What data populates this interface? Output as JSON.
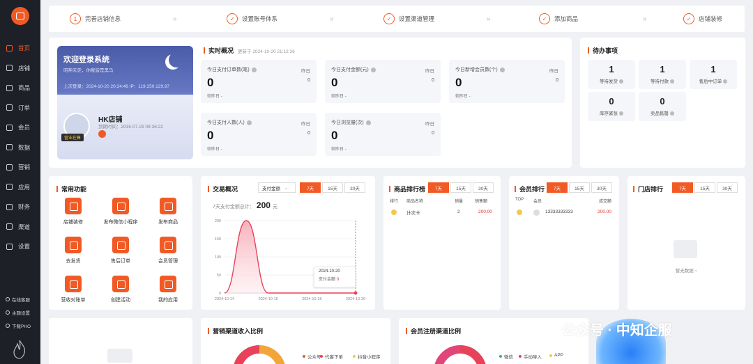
{
  "nav": {
    "items": [
      {
        "label": "首页",
        "icon": "home-icon"
      },
      {
        "label": "店铺",
        "icon": "store-icon"
      },
      {
        "label": "商品",
        "icon": "goods-icon"
      },
      {
        "label": "订单",
        "icon": "order-icon"
      },
      {
        "label": "会员",
        "icon": "member-icon"
      },
      {
        "label": "数据",
        "icon": "data-icon"
      },
      {
        "label": "营销",
        "icon": "marketing-icon"
      },
      {
        "label": "应用",
        "icon": "apps-icon"
      },
      {
        "label": "财务",
        "icon": "finance-icon"
      },
      {
        "label": "渠道",
        "icon": "channel-icon"
      },
      {
        "label": "设置",
        "icon": "settings-icon"
      }
    ],
    "bottom": [
      "在线客服",
      "主题设置",
      "下载PHO"
    ]
  },
  "steps": [
    "完善店铺信息",
    "设置账号体系",
    "设置渠道管理",
    "添加商品",
    "店铺装修"
  ],
  "welcome": {
    "title": "欢迎登录系统",
    "subtitle": "昭神未定，你我皆是黑马",
    "last_login": "上次登录：2024-10-20 20:24:46 IP：119.250.129.97",
    "store_name": "HK店铺",
    "expire": "到期时间：2035-07-29 09:36:22",
    "store_tag": "营业在售"
  },
  "realtime": {
    "title": "实时概况",
    "updated": "更新于 2024-10-20 21:12:26",
    "yesterday_label": "昨日",
    "compare_label": "较昨日 -",
    "stats": [
      {
        "label": "今日支付订单数(笔)",
        "value": "0",
        "yesterday": "0"
      },
      {
        "label": "今日支付金额(元)",
        "value": "0",
        "yesterday": "0"
      },
      {
        "label": "今日新增会员数(个)",
        "value": "0",
        "yesterday": "0"
      },
      {
        "label": "今日支付人数(人)",
        "value": "0",
        "yesterday": "0"
      },
      {
        "label": "今日浏览量(次)",
        "value": "0",
        "yesterday": "0"
      }
    ]
  },
  "todo": {
    "title": "待办事项",
    "items": [
      {
        "count": "1",
        "label": "等待发货"
      },
      {
        "count": "1",
        "label": "等待付款"
      },
      {
        "count": "1",
        "label": "售后中订单"
      },
      {
        "count": "0",
        "label": "库存紧张"
      },
      {
        "count": "0",
        "label": "卖品售罄"
      }
    ]
  },
  "functions": {
    "title": "常用功能",
    "items": [
      "店铺装修",
      "发布微信小程序",
      "发布商品",
      "去发货",
      "售后订单",
      "会员管理",
      "营收对账单",
      "创建活动",
      "我的应用"
    ]
  },
  "trade": {
    "title": "交易概况",
    "select": "支付金额",
    "ranges": [
      "7天",
      "15天",
      "30天"
    ],
    "total_label": "7天支付金额总计：",
    "total_value": "200",
    "total_unit": "元",
    "tooltip_date": "2024-10-20",
    "tooltip_label": "支付金额",
    "tooltip_value": "0"
  },
  "chart_data": {
    "type": "area",
    "x": [
      "2024-10-14",
      "2024-10-15",
      "2024-10-16",
      "2024-10-17",
      "2024-10-18",
      "2024-10-19",
      "2024-10-20"
    ],
    "y": [
      0,
      200,
      0,
      0,
      0,
      0,
      0
    ],
    "x_ticks": [
      "2024-10-14",
      "2024-10-16",
      "2024-10-18",
      "2024-10-20"
    ],
    "y_ticks": [
      "0",
      "50",
      "100",
      "150",
      "200"
    ],
    "ylim": [
      0,
      200
    ],
    "color": "#e8425a"
  },
  "goods_rank": {
    "title": "商品排行榜",
    "ranges": [
      "7天",
      "15天",
      "30天"
    ],
    "headers": [
      "排行",
      "商品名称",
      "销量",
      "销售额"
    ],
    "rows": [
      {
        "name": "计次卡",
        "sales": "2",
        "amount": "200.00"
      }
    ]
  },
  "member_rank": {
    "title": "会员排行",
    "ranges": [
      "7天",
      "15天",
      "30天"
    ],
    "headers": [
      "TOP",
      "会员",
      "成交额"
    ],
    "rows": [
      {
        "phone": "13333333333",
        "amount": "200.00"
      }
    ]
  },
  "store_rank": {
    "title": "门店排行",
    "ranges": [
      "7天",
      "15天",
      "30天"
    ],
    "empty": "暂无数据 ~"
  },
  "channel_income": {
    "title": "营销渠道收入比例",
    "legend": [
      "公众号",
      "代客下单",
      "抖音小程序"
    ]
  },
  "member_reg": {
    "title": "会员注册渠道比例",
    "legend": [
      "微信",
      "手动导入",
      "APP"
    ]
  },
  "watermark": "公众号 · 中知企服",
  "colors": {
    "accent": "#f15a24",
    "sidebar": "#1e2028",
    "price": "#e03030"
  }
}
